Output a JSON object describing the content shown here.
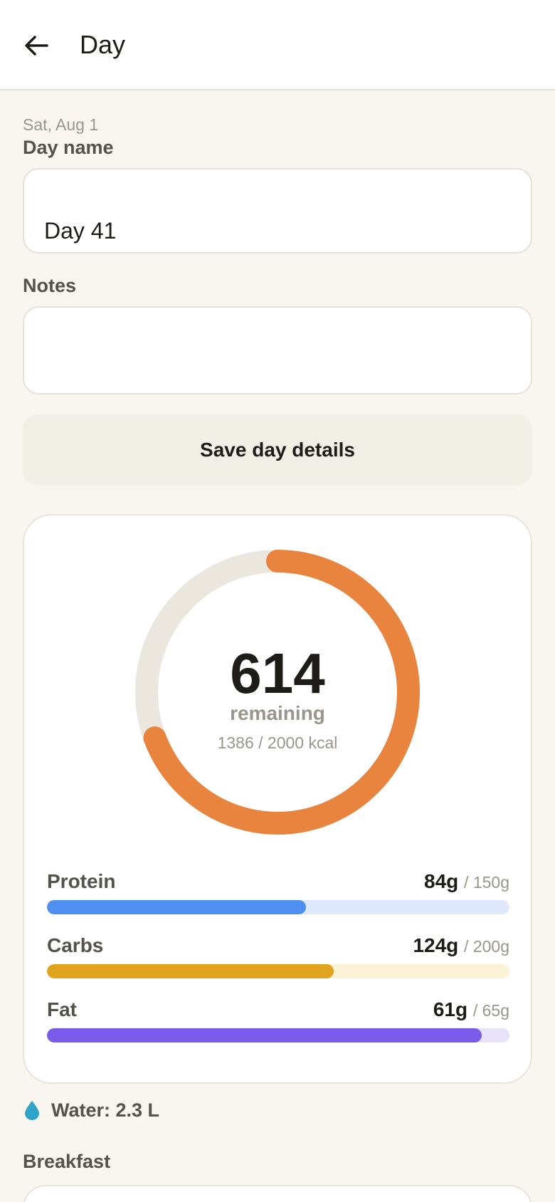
{
  "header": {
    "title": "Day",
    "back_icon": "arrow-left-icon"
  },
  "day": {
    "date": "Sat, Aug 1",
    "name_label": "Day name",
    "name_value": "Day 41",
    "notes_label": "Notes",
    "notes_value": "",
    "save_label": "Save day details"
  },
  "calories": {
    "remaining": "614",
    "remaining_label": "remaining",
    "summary": "1386 / 2000 kcal",
    "eaten": 1386,
    "target": 2000,
    "ring_color": "#e9843f",
    "track_color": "#ebe7de"
  },
  "macros": [
    {
      "name": "Protein",
      "eaten": "84g",
      "target": "/ 150g",
      "fraction": 0.56,
      "color": "#4f8ff0",
      "track": "#dfe9fd"
    },
    {
      "name": "Carbs",
      "eaten": "124g",
      "target": "/ 200g",
      "fraction": 0.62,
      "color": "#e1a41f",
      "track": "#fcf3d6"
    },
    {
      "name": "Fat",
      "eaten": "61g",
      "target": "/ 65g",
      "fraction": 0.94,
      "color": "#7b5cea",
      "track": "#e8e2fb"
    }
  ],
  "water": {
    "label": "Water: 2.3 L",
    "icon": "water-drop-icon",
    "color": "#2fa4c9"
  },
  "meals": {
    "breakfast_label": "Breakfast"
  }
}
